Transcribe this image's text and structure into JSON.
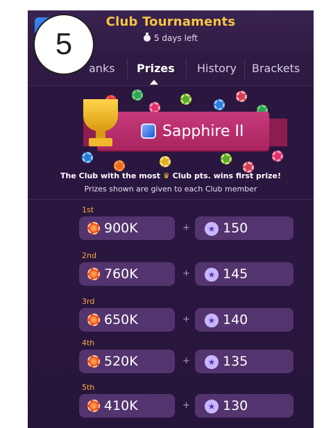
{
  "header": {
    "title": "Club Tournaments",
    "time_left": "5 days left"
  },
  "step_badge": "5",
  "tabs": [
    {
      "label": "anks",
      "active": false
    },
    {
      "label": "Prizes",
      "active": true
    },
    {
      "label": "History",
      "active": false
    },
    {
      "label": "Brackets",
      "active": false
    }
  ],
  "league": {
    "name": "Sapphire II"
  },
  "notice": {
    "line1_pre": "The Club with the most",
    "line1_post": "Club pts. wins first prize!",
    "line2": "Prizes shown are given to each Club member"
  },
  "prizes": [
    {
      "rank": "1st",
      "coins": "900K",
      "stars": "150"
    },
    {
      "rank": "2nd",
      "coins": "760K",
      "stars": "145"
    },
    {
      "rank": "3rd",
      "coins": "650K",
      "stars": "140"
    },
    {
      "rank": "4th",
      "coins": "520K",
      "stars": "135"
    },
    {
      "rank": "5th",
      "coins": "410K",
      "stars": "130"
    }
  ],
  "plus_sign": "+",
  "colors": {
    "accent_gold": "#f7c640",
    "rank_orange": "#f7a941",
    "ribbon_pink": "#c73a7b",
    "background": "#2b163f"
  }
}
